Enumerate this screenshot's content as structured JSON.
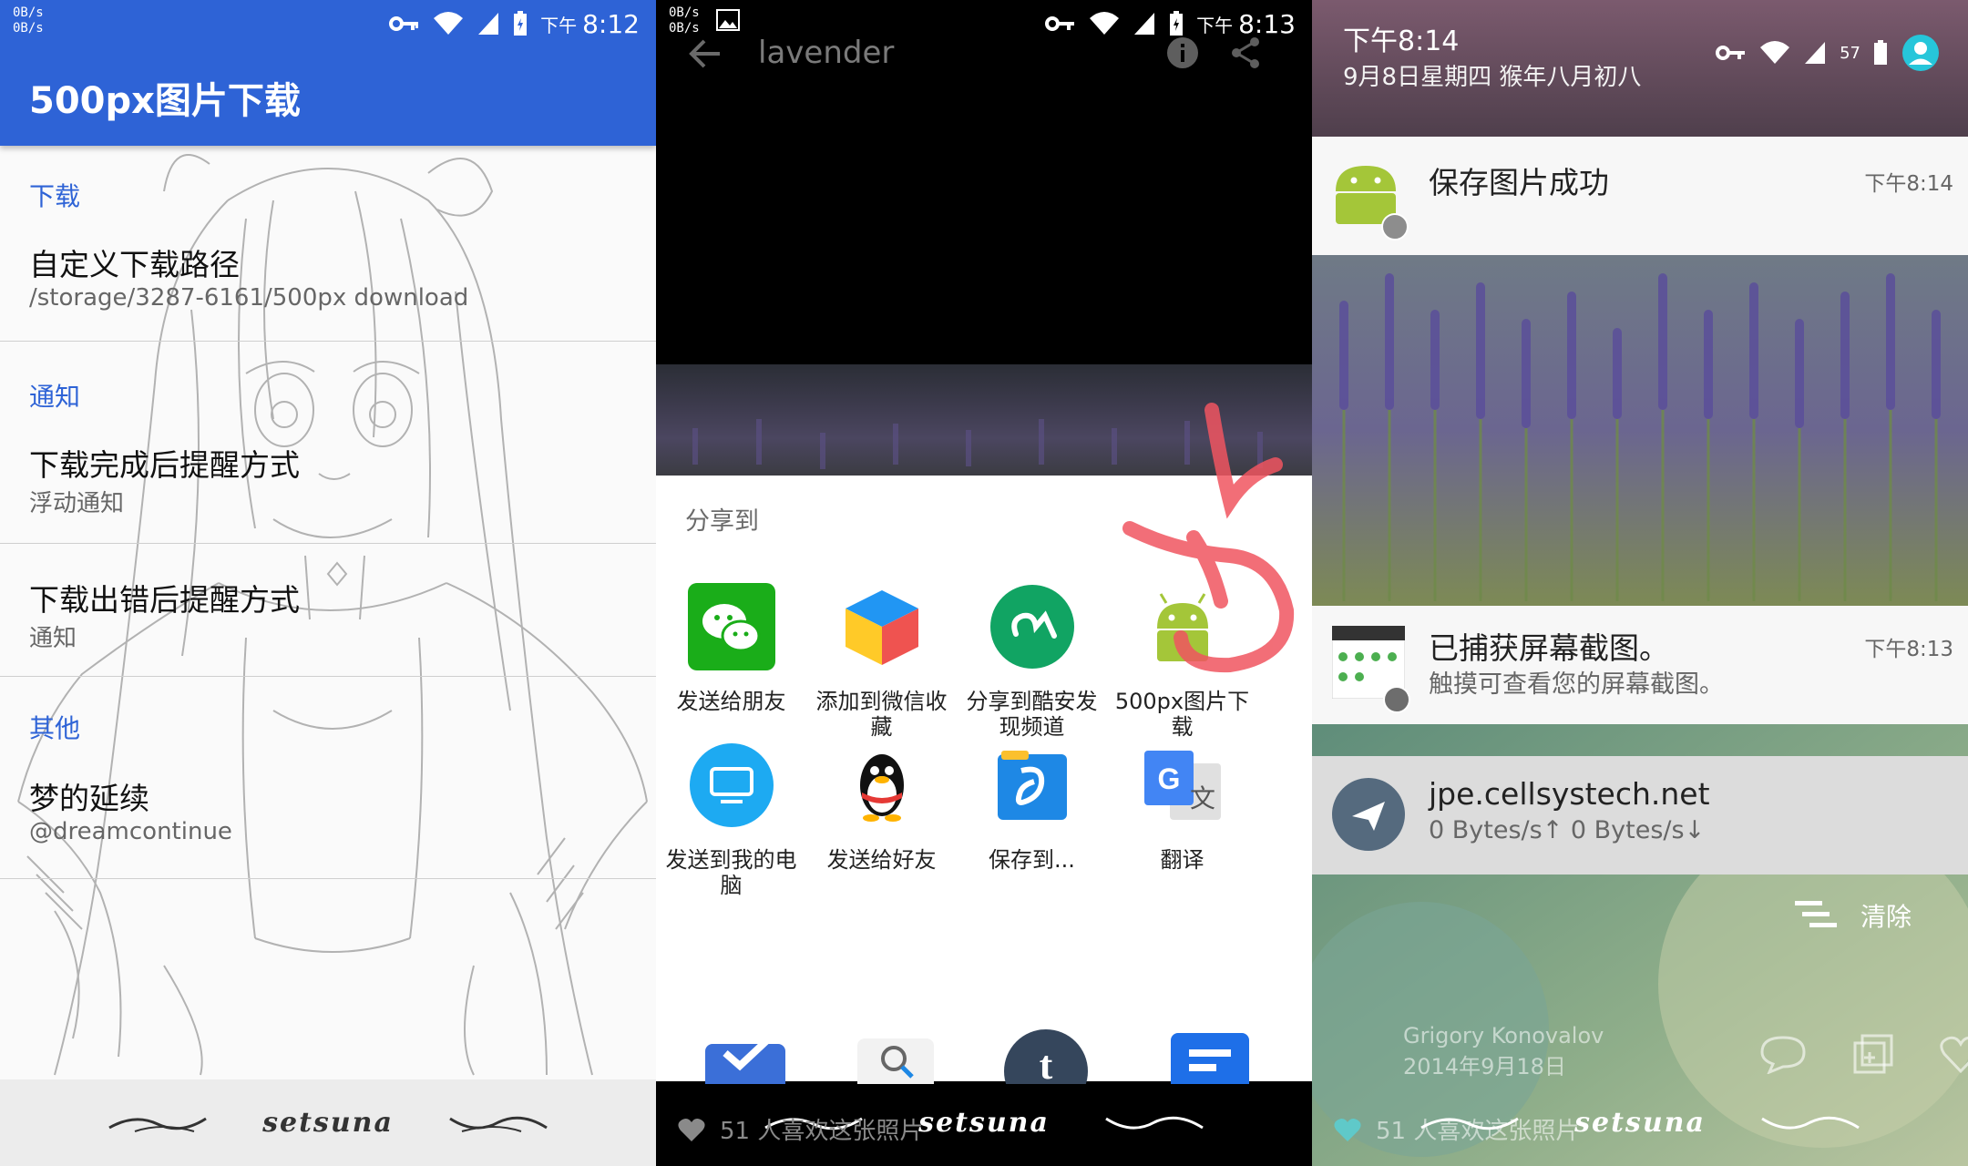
{
  "panel1": {
    "status": {
      "net_up": "0B/s",
      "net_down": "0B/s",
      "ampm": "下午",
      "time": "8:12"
    },
    "app_title": "500px图片下载",
    "sections": [
      {
        "category": "下载",
        "items": [
          {
            "title": "自定义下载路径",
            "subtitle": "/storage/3287-6161/500px download"
          }
        ]
      },
      {
        "category": "通知",
        "items": [
          {
            "title": "下载完成后提醒方式",
            "subtitle": "浮动通知"
          },
          {
            "title": "下载出错后提醒方式",
            "subtitle": "通知"
          }
        ]
      },
      {
        "category": "其他",
        "items": [
          {
            "title": "梦的延续",
            "subtitle": "@dreamcontinue"
          }
        ]
      }
    ],
    "signature": "setsuna"
  },
  "panel2": {
    "status": {
      "net_up": "0B/s",
      "net_down": "0B/s",
      "ampm": "下午",
      "time": "8:13"
    },
    "photo_title": "lavender",
    "sheet_title": "分享到",
    "apps": [
      {
        "label": "发送给朋友",
        "icon": "wechat-icon",
        "color": "#1aad19"
      },
      {
        "label": "添加到微信收藏",
        "icon": "wechat-favorites-cube-icon",
        "color": "#f5a623"
      },
      {
        "label": "分享到酷安发现频道",
        "icon": "coolapk-icon",
        "color": "#0f9d58"
      },
      {
        "label": "500px图片下载",
        "icon": "android-icon",
        "color": "#8bc34a"
      },
      {
        "label": "发送到我的电脑",
        "icon": "computer-icon",
        "color": "#1da1f2"
      },
      {
        "label": "发送给好友",
        "icon": "qq-penguin-icon",
        "color": "#000000"
      },
      {
        "label": "保存到...",
        "icon": "file-manager-icon",
        "color": "#1e88e5"
      },
      {
        "label": "翻译",
        "icon": "google-translate-icon",
        "color": "#4285f4"
      }
    ],
    "likes": "51 人喜欢这张照片",
    "signature": "setsuna"
  },
  "panel3": {
    "time": "下午8:14",
    "date": "9月8日星期四 猴年八月初八",
    "battery": "57",
    "notifications": [
      {
        "title": "保存图片成功",
        "time": "下午8:14"
      },
      {
        "title": "已捕获屏幕截图。",
        "text": "触摸可查看您的屏幕截图。",
        "time": "下午8:13"
      },
      {
        "title": "jpe.cellsystech.net",
        "text": "0 Bytes/s↑  0 Bytes/s↓"
      }
    ],
    "clear_label": "清除",
    "credit_name": "Grigory Konovalov",
    "credit_date": "2014年9月18日",
    "likes": "51 人喜欢这张照片",
    "signature": "setsuna"
  },
  "colors": {
    "primary_blue": "#2e63d6",
    "android_green": "#a4c639",
    "annotation_red": "#f05560"
  }
}
